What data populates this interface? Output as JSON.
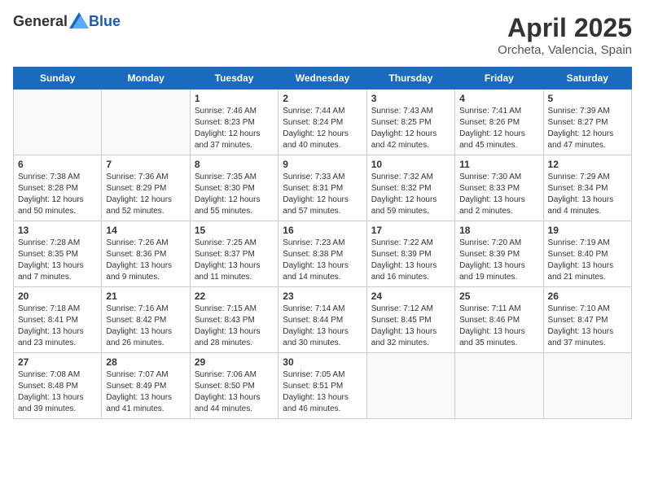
{
  "header": {
    "logo_general": "General",
    "logo_blue": "Blue",
    "month_year": "April 2025",
    "location": "Orcheta, Valencia, Spain"
  },
  "weekdays": [
    "Sunday",
    "Monday",
    "Tuesday",
    "Wednesday",
    "Thursday",
    "Friday",
    "Saturday"
  ],
  "weeks": [
    [
      {
        "day": "",
        "info": ""
      },
      {
        "day": "",
        "info": ""
      },
      {
        "day": "1",
        "info": "Sunrise: 7:46 AM\nSunset: 8:23 PM\nDaylight: 12 hours and 37 minutes."
      },
      {
        "day": "2",
        "info": "Sunrise: 7:44 AM\nSunset: 8:24 PM\nDaylight: 12 hours and 40 minutes."
      },
      {
        "day": "3",
        "info": "Sunrise: 7:43 AM\nSunset: 8:25 PM\nDaylight: 12 hours and 42 minutes."
      },
      {
        "day": "4",
        "info": "Sunrise: 7:41 AM\nSunset: 8:26 PM\nDaylight: 12 hours and 45 minutes."
      },
      {
        "day": "5",
        "info": "Sunrise: 7:39 AM\nSunset: 8:27 PM\nDaylight: 12 hours and 47 minutes."
      }
    ],
    [
      {
        "day": "6",
        "info": "Sunrise: 7:38 AM\nSunset: 8:28 PM\nDaylight: 12 hours and 50 minutes."
      },
      {
        "day": "7",
        "info": "Sunrise: 7:36 AM\nSunset: 8:29 PM\nDaylight: 12 hours and 52 minutes."
      },
      {
        "day": "8",
        "info": "Sunrise: 7:35 AM\nSunset: 8:30 PM\nDaylight: 12 hours and 55 minutes."
      },
      {
        "day": "9",
        "info": "Sunrise: 7:33 AM\nSunset: 8:31 PM\nDaylight: 12 hours and 57 minutes."
      },
      {
        "day": "10",
        "info": "Sunrise: 7:32 AM\nSunset: 8:32 PM\nDaylight: 12 hours and 59 minutes."
      },
      {
        "day": "11",
        "info": "Sunrise: 7:30 AM\nSunset: 8:33 PM\nDaylight: 13 hours and 2 minutes."
      },
      {
        "day": "12",
        "info": "Sunrise: 7:29 AM\nSunset: 8:34 PM\nDaylight: 13 hours and 4 minutes."
      }
    ],
    [
      {
        "day": "13",
        "info": "Sunrise: 7:28 AM\nSunset: 8:35 PM\nDaylight: 13 hours and 7 minutes."
      },
      {
        "day": "14",
        "info": "Sunrise: 7:26 AM\nSunset: 8:36 PM\nDaylight: 13 hours and 9 minutes."
      },
      {
        "day": "15",
        "info": "Sunrise: 7:25 AM\nSunset: 8:37 PM\nDaylight: 13 hours and 11 minutes."
      },
      {
        "day": "16",
        "info": "Sunrise: 7:23 AM\nSunset: 8:38 PM\nDaylight: 13 hours and 14 minutes."
      },
      {
        "day": "17",
        "info": "Sunrise: 7:22 AM\nSunset: 8:39 PM\nDaylight: 13 hours and 16 minutes."
      },
      {
        "day": "18",
        "info": "Sunrise: 7:20 AM\nSunset: 8:39 PM\nDaylight: 13 hours and 19 minutes."
      },
      {
        "day": "19",
        "info": "Sunrise: 7:19 AM\nSunset: 8:40 PM\nDaylight: 13 hours and 21 minutes."
      }
    ],
    [
      {
        "day": "20",
        "info": "Sunrise: 7:18 AM\nSunset: 8:41 PM\nDaylight: 13 hours and 23 minutes."
      },
      {
        "day": "21",
        "info": "Sunrise: 7:16 AM\nSunset: 8:42 PM\nDaylight: 13 hours and 26 minutes."
      },
      {
        "day": "22",
        "info": "Sunrise: 7:15 AM\nSunset: 8:43 PM\nDaylight: 13 hours and 28 minutes."
      },
      {
        "day": "23",
        "info": "Sunrise: 7:14 AM\nSunset: 8:44 PM\nDaylight: 13 hours and 30 minutes."
      },
      {
        "day": "24",
        "info": "Sunrise: 7:12 AM\nSunset: 8:45 PM\nDaylight: 13 hours and 32 minutes."
      },
      {
        "day": "25",
        "info": "Sunrise: 7:11 AM\nSunset: 8:46 PM\nDaylight: 13 hours and 35 minutes."
      },
      {
        "day": "26",
        "info": "Sunrise: 7:10 AM\nSunset: 8:47 PM\nDaylight: 13 hours and 37 minutes."
      }
    ],
    [
      {
        "day": "27",
        "info": "Sunrise: 7:08 AM\nSunset: 8:48 PM\nDaylight: 13 hours and 39 minutes."
      },
      {
        "day": "28",
        "info": "Sunrise: 7:07 AM\nSunset: 8:49 PM\nDaylight: 13 hours and 41 minutes."
      },
      {
        "day": "29",
        "info": "Sunrise: 7:06 AM\nSunset: 8:50 PM\nDaylight: 13 hours and 44 minutes."
      },
      {
        "day": "30",
        "info": "Sunrise: 7:05 AM\nSunset: 8:51 PM\nDaylight: 13 hours and 46 minutes."
      },
      {
        "day": "",
        "info": ""
      },
      {
        "day": "",
        "info": ""
      },
      {
        "day": "",
        "info": ""
      }
    ]
  ]
}
